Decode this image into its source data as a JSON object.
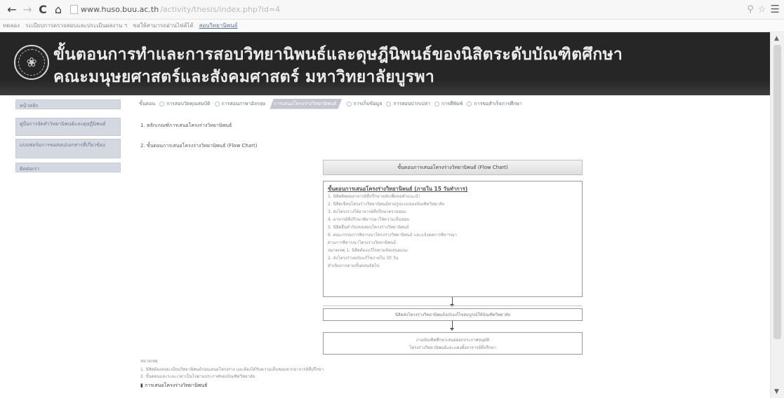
{
  "browser": {
    "url_host": "www.huso.buu.ac.th",
    "url_path": "/activity/thesis/index.php?id=4",
    "icons": {
      "back": "back-arrow-icon",
      "forward": "forward-arrow-icon",
      "reload": "reload-icon",
      "home": "home-icon",
      "menu": "hamburger-menu-icon"
    }
  },
  "bookmarks": [
    "ทดลอง",
    "ระเบียบการตรวจสอบและประเมินผลงาน ฯ",
    "ขอให้สามารถอ่านไฟล์ได้",
    "สอบวิทยานิพนธ์"
  ],
  "banner": {
    "title_line1": "ขั้นตอนการทำและการสอบวิทยานิพนธ์และดุษฎีนิพนธ์ของนิสิตระดับบัณฑิตศึกษา",
    "title_line2": "คณะมนุษยศาสตร์และสังคมศาสตร์ มหาวิทยาลัยบูรพา"
  },
  "sidebar": {
    "items": [
      "หน้าหลัก",
      "คู่มือการจัดทำวิทยานิพนธ์และดุษฎีนิพนธ์",
      "แบบฟอร์มการขอสอบ/เอกสารที่เกี่ยวข้อง",
      "ติดต่อเรา"
    ]
  },
  "tabs": [
    {
      "label": "ขั้นตอน",
      "active": false
    },
    {
      "label": "การสอบวัดคุณสมบัติ",
      "active": false
    },
    {
      "label": "การสอบภาษาอังกฤษ",
      "active": false
    },
    {
      "label": "การเสนอโครงร่างวิทยานิพนธ์",
      "active": true
    },
    {
      "label": "การเก็บข้อมูล",
      "active": false
    },
    {
      "label": "การสอบปากเปล่า",
      "active": false
    },
    {
      "label": "การตีพิมพ์",
      "active": false
    },
    {
      "label": "การขอสำเร็จการศึกษา",
      "active": false
    }
  ],
  "content": {
    "line1": "1. หลักเกณฑ์การเสนอโครงร่างวิทยานิพนธ์",
    "line2": "2. ขั้นตอนการเสนอโครงร่างวิทยานิพนธ์ (Flow Chart)"
  },
  "flowchart": {
    "header": "ขั้นตอนการเสนอโครงร่างวิทยานิพนธ์ (Flow Chart)",
    "box_title": "ขั้นตอนการเสนอโครงร่างวิทยานิพนธ์ (ภายใน 15 วันทำการ)",
    "box_lines": [
      "1. นิสิตติดต่ออาจารย์ที่ปรึกษาหลักเพื่อขอคำแนะนำ",
      "2. นิสิตเขียนโครงร่างวิทยานิพนธ์ตามรูปแบบของบัณฑิตวิทยาลัย",
      "3. ส่งโครงร่างให้อาจารย์ที่ปรึกษาตรวจสอบ",
      "4. อาจารย์ที่ปรึกษาพิจารณาให้ความเห็นชอบ",
      "5. นิสิตยื่นคำร้องขอสอบโครงร่างวิทยานิพนธ์",
      "6. คณะกรรมการพิจารณาโครงร่างวิทยานิพนธ์ และแจ้งผลการพิจารณา",
      "    ผ่านการพิจารณาโครงร่างวิทยานิพนธ์",
      "    หมายเหตุ 1. นิสิตต้องแก้ไขตามข้อเสนอแนะ",
      "             2. ส่งโครงร่างฉบับแก้ไขภายใน 30 วัน",
      "    ดำเนินการตามขั้นตอนถัดไป"
    ],
    "step2": "นิสิตส่งโครงร่างวิทยานิพนธ์ฉบับแก้ไขสมบูรณ์ให้บัณฑิตวิทยาลัย",
    "step3_line1": "งานบัณฑิตศึกษาเสนอออกประกาศอนุมัติ",
    "step3_line2": "โครงร่างวิทยานิพนธ์และแต่งตั้งอาจารย์ที่ปรึกษา"
  },
  "footnotes": [
    "หมายเหตุ",
    "1. นิสิตต้องลงทะเบียนวิทยานิพนธ์ก่อนเสนอโครงร่าง และต้องได้รับความเห็นชอบจากอาจารย์ที่ปรึกษา",
    "2. ขั้นตอนและระยะเวลาเป็นไปตามประกาศของบัณฑิตวิทยาลัย",
    "การเสนอโครงร่างวิทยานิพนธ์"
  ]
}
